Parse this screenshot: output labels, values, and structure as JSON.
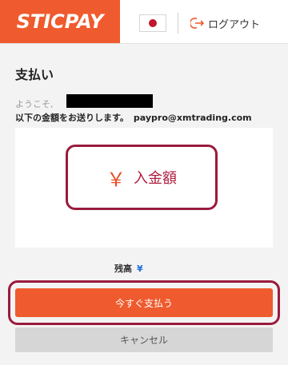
{
  "header": {
    "logo_text": "STICPAY",
    "language_flag": "japan-flag",
    "logout_label": "ログアウト",
    "logout_icon": "logout-icon"
  },
  "main": {
    "title": "支払い",
    "welcome_text": "ようこそ,",
    "instruction_text": "以下の金額をお送りします。",
    "recipient_email": "paypro@xmtrading.com",
    "amount": {
      "currency_symbol": "￥",
      "placeholder": "入金額"
    },
    "balance_label": "残高",
    "balance_currency": "¥",
    "pay_now_label": "今すぐ支払う",
    "cancel_label": "キャンセル"
  },
  "colors": {
    "brand": "#ef5b2e",
    "highlight_outline": "#9a1b3d"
  }
}
